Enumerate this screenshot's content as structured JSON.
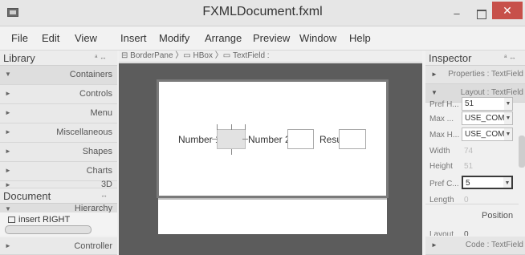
{
  "window": {
    "title": "FXMLDocument.fxml",
    "minimize": "–",
    "close": "✕"
  },
  "menu": [
    "File",
    "Edit",
    "View",
    "Insert",
    "Modify",
    "Arrange",
    "Preview",
    "Window",
    "Help"
  ],
  "library": {
    "header": "Library",
    "controls": "ᵃ ↔",
    "items": [
      "Containers",
      "Controls",
      "Menu",
      "Miscellaneous",
      "Shapes",
      "Charts",
      "3D"
    ]
  },
  "document": {
    "header": "Document",
    "controls": "↔",
    "hierarchy_label": "Hierarchy",
    "hierarchy_item": "insert RIGHT",
    "controller_label": "Controller"
  },
  "breadcrumb": "⊟ BorderPane 〉▭ HBox 〉▭ TextField :",
  "form": {
    "labels": [
      "Number 1",
      "Number 2",
      "Result"
    ]
  },
  "inspector": {
    "header": "Inspector",
    "controls": "ᵃ ↔",
    "sections": {
      "properties": "Properties : TextField",
      "layout": "Layout : TextField",
      "code": "Code : TextField"
    },
    "props": [
      {
        "label": "Pref H...",
        "value": "51",
        "kind": "combo"
      },
      {
        "label": "Max ...",
        "value": "USE_COMPI",
        "kind": "combo"
      },
      {
        "label": "Max H...",
        "value": "USE_COMPI",
        "kind": "combo"
      },
      {
        "label": "Width",
        "value": "74",
        "kind": "readonly"
      },
      {
        "label": "Height",
        "value": "51",
        "kind": "readonly"
      },
      {
        "label": "Pref C...",
        "value": "5",
        "kind": "combo-focus"
      },
      {
        "label": "Length",
        "value": "0",
        "kind": "readonly"
      }
    ],
    "position_label": "Position",
    "layout_x_label": "Layout",
    "layout_x_value": "0"
  }
}
